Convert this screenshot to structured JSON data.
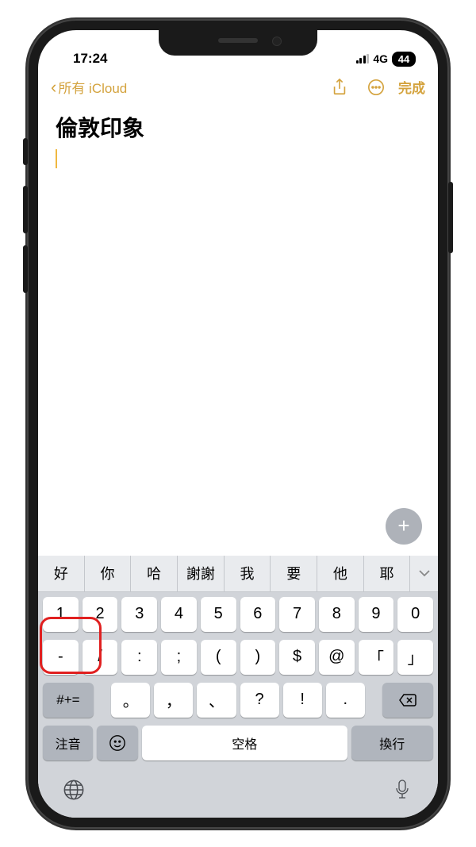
{
  "status": {
    "time": "17:24",
    "network": "4G",
    "battery": "44"
  },
  "nav": {
    "back": "所有 iCloud",
    "done": "完成"
  },
  "note": {
    "title": "倫敦印象"
  },
  "suggestions": [
    "好",
    "你",
    "哈",
    "謝謝",
    "我",
    "要",
    "他",
    "耶"
  ],
  "kb": {
    "row1": [
      "1",
      "2",
      "3",
      "4",
      "5",
      "6",
      "7",
      "8",
      "9",
      "0"
    ],
    "row2": [
      "-",
      "/",
      ":",
      ";",
      "(",
      ")",
      "$",
      "@",
      "「",
      "」"
    ],
    "row3_sym": "#+=",
    "row3_keys": [
      "。",
      "，",
      "、",
      "?",
      "!",
      "."
    ],
    "zhuyin": "注音",
    "space": "空格",
    "return": "換行"
  }
}
